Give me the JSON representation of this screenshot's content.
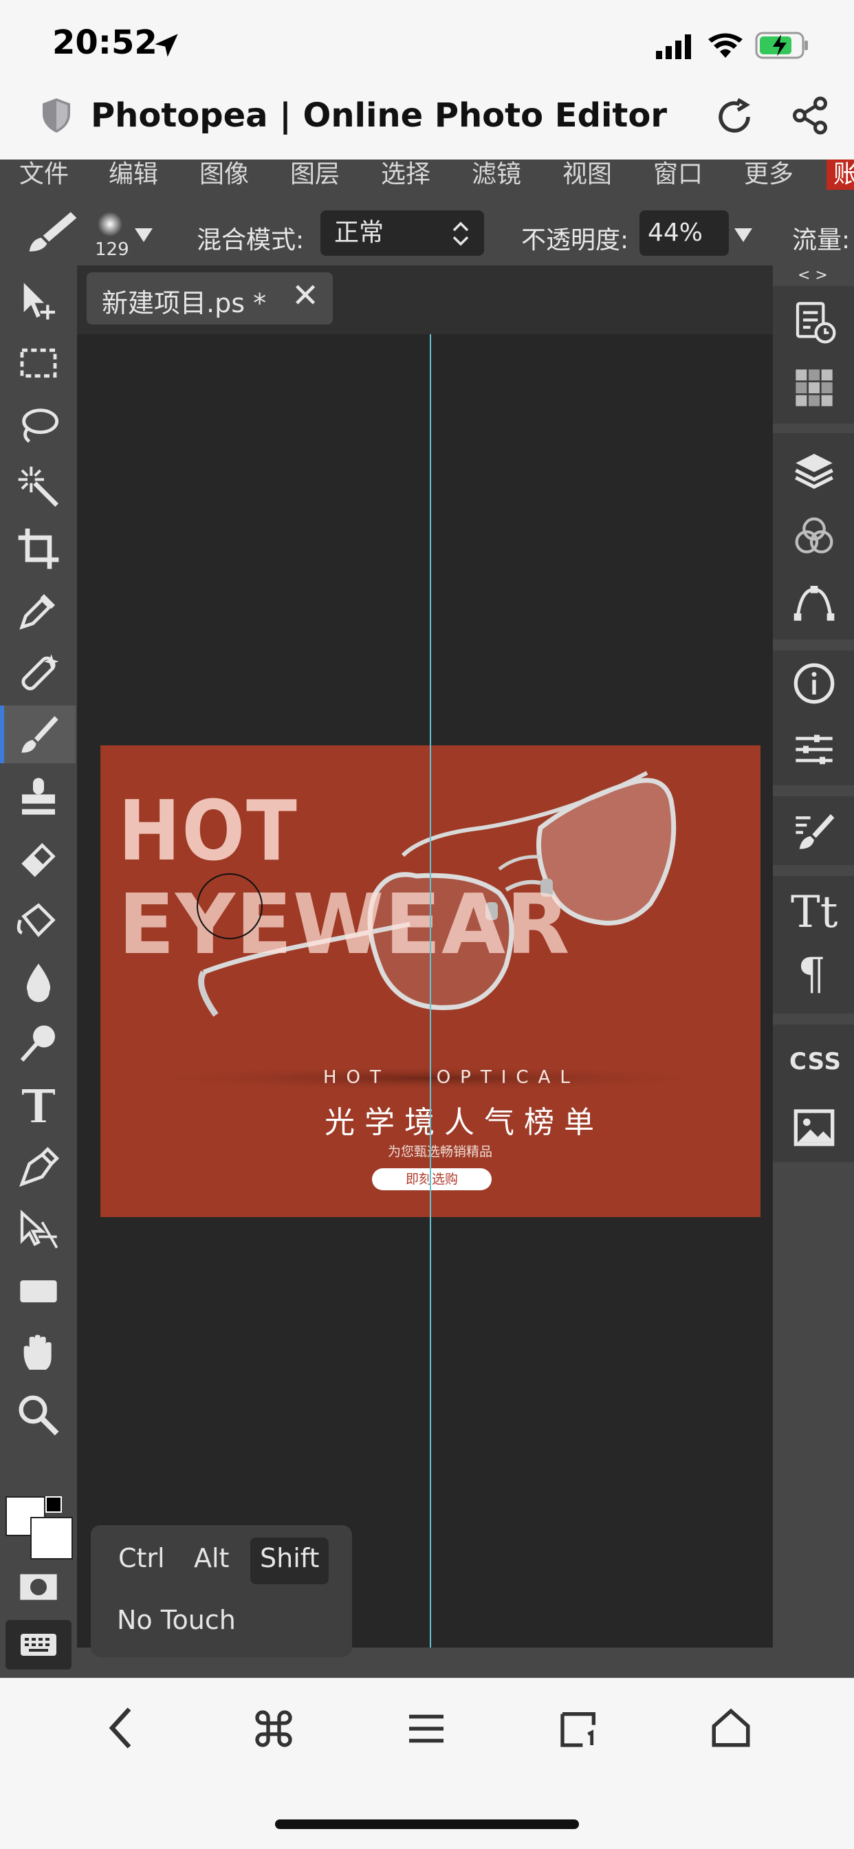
{
  "status_bar": {
    "time": "20:52"
  },
  "browser": {
    "title": "Photopea | Online Photo Editor"
  },
  "menu": {
    "items": [
      "文件",
      "编辑",
      "图像",
      "图层",
      "选择",
      "滤镜",
      "视图",
      "窗口",
      "更多",
      "账"
    ]
  },
  "options": {
    "brush_size": "129",
    "blend_label": "混合模式:",
    "blend_value": "正常",
    "opacity_label": "不透明度:",
    "opacity_value": "44%",
    "flow_label": "流量:"
  },
  "document": {
    "tab_name": "新建项目.ps",
    "tab_modified": "*"
  },
  "canvas": {
    "title_line1": "HOT",
    "title_line2": "EYEWEAR",
    "subtitle_en": "HOT   OPTICAL",
    "subtitle_cn": "光学境人气榜单",
    "tagline": "为您甄选畅销精品",
    "cta": "即刻选购",
    "bg_color": "#9e3a26"
  },
  "right_panel": {
    "toggle": "< >",
    "css_label": "CSS"
  },
  "modifier_popup": {
    "ctrl": "Ctrl",
    "alt": "Alt",
    "shift": "Shift",
    "no_touch": "No Touch"
  },
  "colors": {
    "accent": "#3d7bd9",
    "guide": "#5fc3d1",
    "cta_text": "#b0392b"
  }
}
